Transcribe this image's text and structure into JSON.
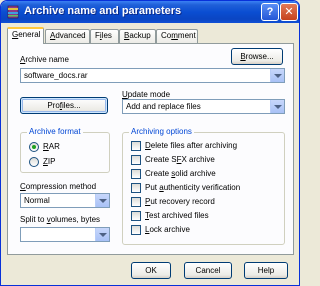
{
  "window": {
    "title": "Archive name and parameters",
    "help_glyph": "?",
    "close_glyph": "✕"
  },
  "tabs": [
    {
      "label": "General",
      "underline": "G",
      "rest": "eneral"
    },
    {
      "label": "Advanced",
      "underline": "A",
      "rest": "dvanced"
    },
    {
      "label": "Files",
      "pre": "F",
      "underline": "i",
      "rest": "les"
    },
    {
      "label": "Backup",
      "underline": "B",
      "rest": "ackup"
    },
    {
      "label": "Comment",
      "pre": "Co",
      "underline": "m",
      "rest": "ment"
    }
  ],
  "archive_name": {
    "label_pre": "",
    "label_ul": "A",
    "label_rest": "rchive name",
    "value": "software_docs.rar"
  },
  "browse_button": {
    "pre": "",
    "ul": "B",
    "rest": "rowse..."
  },
  "profiles_button": {
    "pre": "Pro",
    "ul": "f",
    "rest": "iles..."
  },
  "update_mode": {
    "label_pre": "",
    "label_ul": "U",
    "label_rest": "pdate mode",
    "value": "Add and replace files"
  },
  "archive_format": {
    "title": "Archive format",
    "options": [
      {
        "label": "RAR",
        "underline": "R",
        "rest": "AR",
        "selected": true
      },
      {
        "label": "ZIP",
        "underline": "Z",
        "rest": "IP",
        "selected": false
      }
    ]
  },
  "compression": {
    "label_pre": "",
    "label_ul": "C",
    "label_rest": "ompression method",
    "value": "Normal"
  },
  "split": {
    "label_pre": "Split to ",
    "label_ul": "v",
    "label_rest": "olumes, bytes",
    "value": ""
  },
  "archiving_options": {
    "title": "Archiving options",
    "items": [
      {
        "label": "Delete files after archiving",
        "pre": "",
        "ul": "D",
        "rest": "elete files after archiving",
        "checked": false
      },
      {
        "label": "Create SFX archive",
        "pre": "Create S",
        "ul": "F",
        "rest": "X archive",
        "checked": false
      },
      {
        "label": "Create solid archive",
        "pre": "Create ",
        "ul": "s",
        "rest": "olid archive",
        "checked": false
      },
      {
        "label": "Put authenticity verification",
        "pre": "Put ",
        "ul": "a",
        "rest": "uthenticity verification",
        "checked": false
      },
      {
        "label": "Put recovery record",
        "pre": "",
        "ul": "P",
        "rest": "ut recovery record",
        "checked": false
      },
      {
        "label": "Test archived files",
        "pre": "",
        "ul": "T",
        "rest": "est archived files",
        "checked": false
      },
      {
        "label": "Lock archive",
        "pre": "",
        "ul": "L",
        "rest": "ock archive",
        "checked": false
      }
    ]
  },
  "footer": {
    "ok": "OK",
    "cancel": "Cancel",
    "help": "Help"
  },
  "colors": {
    "accent": "#0046d5",
    "titlebar": "#0a4ed2",
    "tab_highlight": "#ffc83c",
    "dialog_bg": "#ece9d8"
  }
}
